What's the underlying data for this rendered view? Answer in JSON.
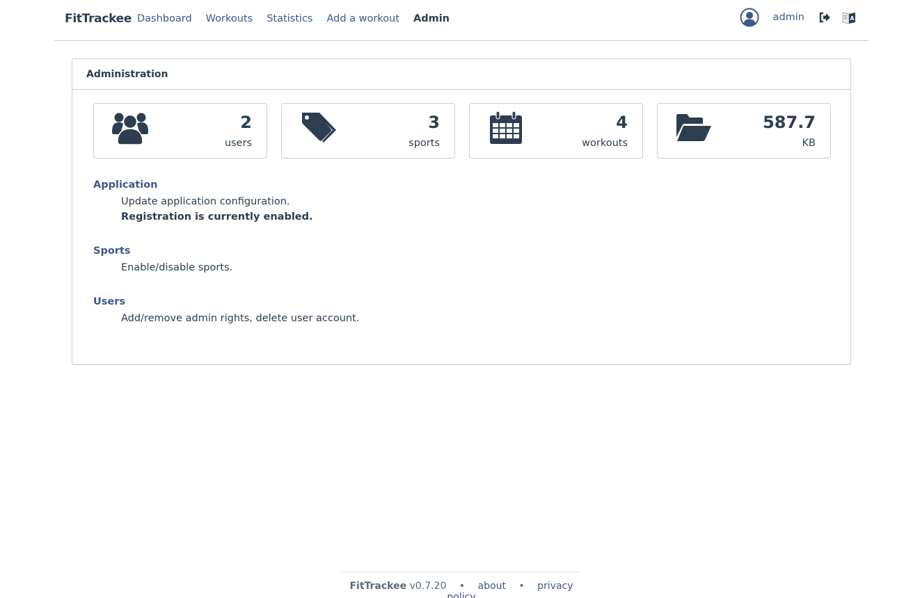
{
  "navbar": {
    "brand": "FitTrackee",
    "links": [
      {
        "label": "Dashboard",
        "active": false
      },
      {
        "label": "Workouts",
        "active": false
      },
      {
        "label": "Statistics",
        "active": false
      },
      {
        "label": "Add a workout",
        "active": false
      },
      {
        "label": "Admin",
        "active": true
      }
    ],
    "username": "admin",
    "icons": {
      "avatar": "user-circle-icon",
      "logout": "sign-out-icon",
      "language": "language-icon"
    }
  },
  "admin_card": {
    "title": "Administration",
    "stats": [
      {
        "icon": "users-icon",
        "value": "2",
        "label": "users"
      },
      {
        "icon": "tags-icon",
        "value": "3",
        "label": "sports"
      },
      {
        "icon": "calendar-icon",
        "value": "4",
        "label": "workouts"
      },
      {
        "icon": "folder-open-icon",
        "value": "587.7",
        "label": "KB"
      }
    ],
    "sections": [
      {
        "title": "Application",
        "lines": [
          "Update application configuration.",
          "Registration is currently enabled."
        ]
      },
      {
        "title": "Sports",
        "lines": [
          "Enable/disable sports."
        ]
      },
      {
        "title": "Users",
        "lines": [
          "Add/remove admin rights, delete user account."
        ]
      }
    ]
  },
  "footer": {
    "name": "FitTrackee",
    "version": "v0.7.20",
    "separator": "•",
    "about": "about",
    "privacy": "privacy policy"
  },
  "colors": {
    "primary": "#2c3e50",
    "link": "#40578a",
    "border": "#c8cdd3"
  }
}
